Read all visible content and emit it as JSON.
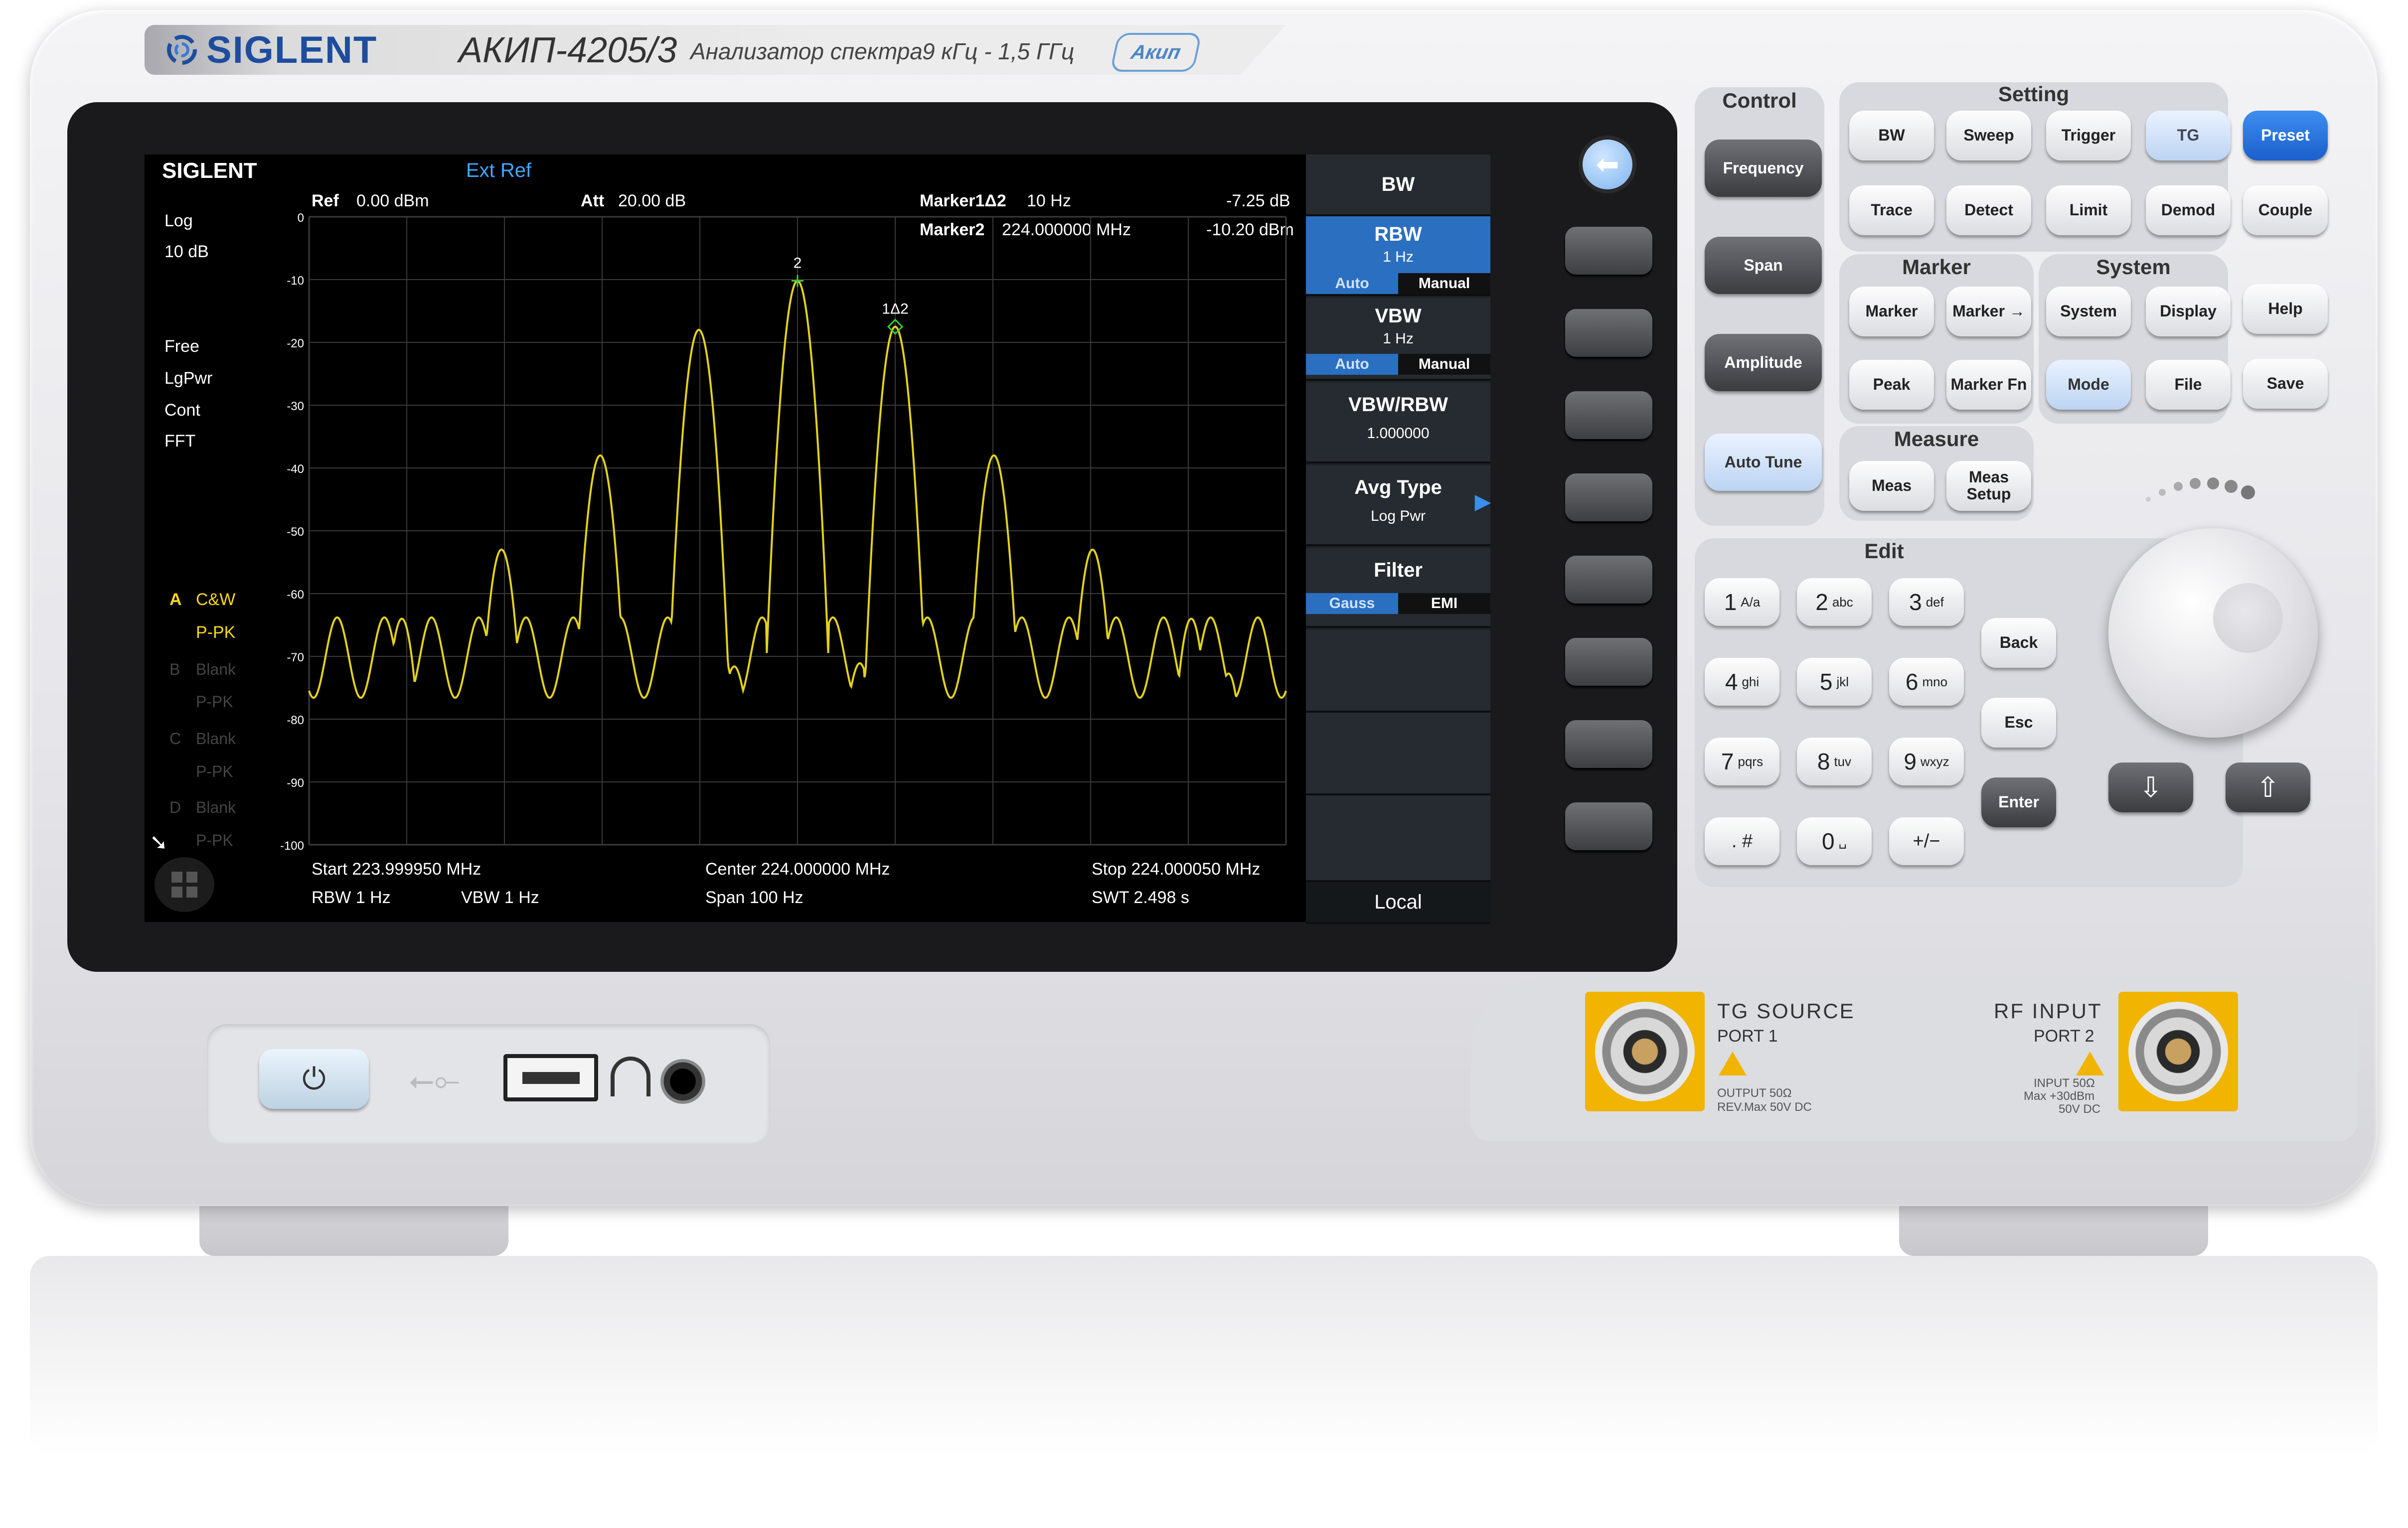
{
  "brand": {
    "logo": "SIGLENT",
    "model": "АКИП-4205/3",
    "subtitle": "Анализатор спектра",
    "freq_range": "9 кГц - 1,5 ГГц",
    "akip_logo": "Акип"
  },
  "screen": {
    "logo": "SIGLENT",
    "ext_ref": "Ext Ref",
    "top": {
      "ref_label": "Ref",
      "ref_value": "0.00 dBm",
      "att_label": "Att",
      "att_value": "20.00 dB",
      "marker1_label": "Marker1Δ2",
      "marker1_freq": "10 Hz",
      "marker1_level": "-7.25 dB",
      "marker2_label": "Marker2",
      "marker2_freq": "224.000000 MHz",
      "marker2_level": "-10.20 dBm"
    },
    "left": {
      "scale": "Log",
      "div": "10 dB",
      "trig": "Free",
      "avg": "LgPwr",
      "sweep": "Cont",
      "mode": "FFT",
      "traceA_letter": "A",
      "traceA_mode": "C&W",
      "traceA_det": "P-PK",
      "traceB_letter": "B",
      "traceB_mode": "Blank",
      "traceB_det": "P-PK",
      "traceC_letter": "C",
      "traceC_mode": "Blank",
      "traceC_det": "P-PK",
      "traceD_letter": "D",
      "traceD_mode": "Blank",
      "traceD_det": "P-PK"
    },
    "bottom": {
      "start": "Start  223.999950 MHz",
      "center": "Center  224.000000 MHz",
      "stop": "Stop  224.000050 MHz",
      "rbw": "RBW  1 Hz",
      "vbw": "VBW  1 Hz",
      "span": "Span    100 Hz",
      "swt": "SWT  2.498 s"
    },
    "marker_labels": {
      "m2": "2",
      "m1": "1Δ2"
    },
    "menu": {
      "title": "BW",
      "rbw": {
        "label": "RBW",
        "value": "1 Hz",
        "auto": "Auto",
        "manual": "Manual"
      },
      "vbw": {
        "label": "VBW",
        "value": "1 Hz",
        "auto": "Auto",
        "manual": "Manual"
      },
      "ratio": {
        "label": "VBW/RBW",
        "value": "1.000000"
      },
      "avg": {
        "label": "Avg Type",
        "value": "Log Pwr"
      },
      "filter": {
        "label": "Filter",
        "gauss": "Gauss",
        "emi": "EMI"
      },
      "local": "Local"
    }
  },
  "chart_data": {
    "type": "line",
    "title": "",
    "xlabel": "",
    "ylabel": "",
    "ylim": [
      -100,
      0
    ],
    "xlim": [
      -50,
      50
    ],
    "yticks": [
      "0",
      "-10",
      "-20",
      "-30",
      "-40",
      "-50",
      "-60",
      "-70",
      "-80",
      "-90",
      "-100"
    ],
    "peaks": [
      {
        "x": -40.5,
        "y": -64
      },
      {
        "x": -30.3,
        "y": -53
      },
      {
        "x": -20.2,
        "y": -38
      },
      {
        "x": -10.1,
        "y": -18
      },
      {
        "x": 0,
        "y": -10.2
      },
      {
        "x": 10.0,
        "y": -17.5
      },
      {
        "x": 20.1,
        "y": -38
      },
      {
        "x": 30.2,
        "y": -53
      },
      {
        "x": 40.3,
        "y": -64
      }
    ],
    "markers": [
      {
        "label": "2",
        "x": 0,
        "y": -10.2
      },
      {
        "label": "1Δ2",
        "x": 10,
        "y": -17.5
      }
    ],
    "color": "#e3d21c"
  },
  "panel": {
    "control": {
      "title": "Control",
      "frequency": "Frequency",
      "span": "Span",
      "amplitude": "Amplitude",
      "autotune": "Auto Tune"
    },
    "setting": {
      "title": "Setting",
      "bw": "BW",
      "sweep": "Sweep",
      "trigger": "Trigger",
      "tg": "TG",
      "trace": "Trace",
      "detect": "Detect",
      "limit": "Limit",
      "demod": "Demod"
    },
    "preset": "Preset",
    "couple": "Couple",
    "help": "Help",
    "save": "Save",
    "marker": {
      "title": "Marker",
      "marker": "Marker",
      "marker_to": "Marker →",
      "peak": "Peak",
      "marker_fn": "Marker Fn"
    },
    "system": {
      "title": "System",
      "system": "System",
      "display": "Display",
      "mode": "Mode",
      "file": "File"
    },
    "measure": {
      "title": "Measure",
      "meas": "Meas",
      "meas_setup": "Meas Setup"
    },
    "edit": {
      "title": "Edit",
      "back": "Back",
      "esc": "Esc",
      "enter": "Enter",
      "k1": "1",
      "k1s": "A/a",
      "k2": "2",
      "k2s": "abc",
      "k3": "3",
      "k3s": "def",
      "k4": "4",
      "k4s": "ghi",
      "k5": "5",
      "k5s": "jkl",
      "k6": "6",
      "k6s": "mno",
      "k7": "7",
      "k7s": "pqrs",
      "k8": "8",
      "k8s": "tuv",
      "k9": "9",
      "k9s": "wxyz",
      "kdot": ". #",
      "k0": "0",
      "k0s": "␣",
      "kpm": "+/−"
    }
  },
  "ports": {
    "tg_title": "TG SOURCE",
    "tg_port": "PORT 1",
    "tg_spec1": "OUTPUT 50Ω",
    "tg_spec2": "REV.Max 50V DC",
    "rf_title": "RF INPUT",
    "rf_port": "PORT 2",
    "rf_spec1": "INPUT 50Ω",
    "rf_spec2": "Max +30dBm",
    "rf_spec3": "50V DC"
  }
}
